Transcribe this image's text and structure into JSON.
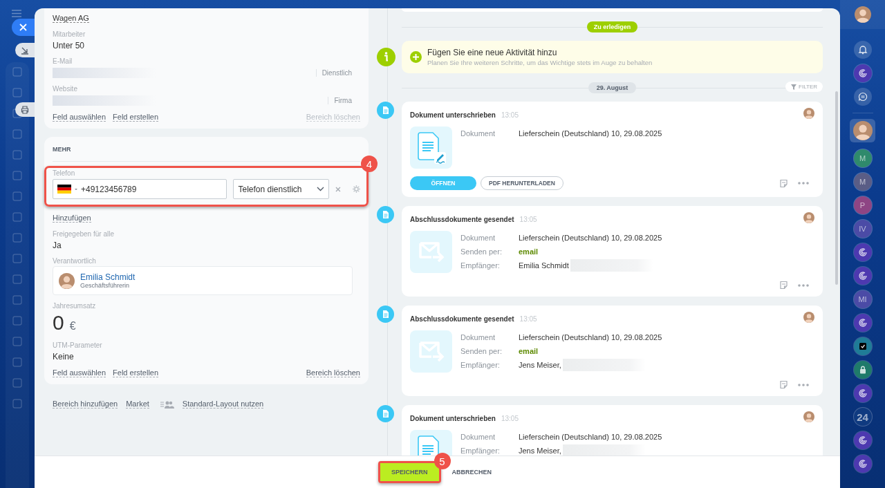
{
  "card_top": {
    "company_link": "Wagen AG",
    "employees": {
      "label": "Mitarbeiter",
      "value": "Unter 50"
    },
    "email": {
      "label": "E-Mail",
      "value_hidden": true,
      "type": "Dienstlich"
    },
    "website": {
      "label": "Website",
      "value_hidden": true,
      "type": "Firma"
    },
    "links": [
      "Feld auswählen",
      "Feld erstellen"
    ],
    "delete_link": "Bereich löschen",
    "delete_disabled": true
  },
  "section_more": {
    "title": "MEHR",
    "phone": {
      "label": "Telefon",
      "value": "+49123456789",
      "type": "Telefon dienstlich",
      "callout": "4"
    },
    "add_link": "Hinzufügen",
    "shared": {
      "label": "Freigegeben für alle",
      "value": "Ja"
    },
    "responsible": {
      "label": "Verantwortlich",
      "name": "Emilia Schmidt",
      "role": "Geschäftsführerin"
    },
    "revenue": {
      "label": "Jahresumsatz",
      "amount": "0",
      "currency": "€"
    },
    "utm": {
      "label": "UTM-Parameter",
      "value": "Keine"
    },
    "links": [
      "Feld auswählen",
      "Feld erstellen"
    ],
    "delete_link": "Bereich löschen",
    "delete_disabled": false
  },
  "footer_links": [
    "Bereich hinzufügen",
    "Market"
  ],
  "layout_link": "Standard-Layout nutzen",
  "timeline": {
    "todo_label": "Zu erledigen",
    "add_activity": {
      "title": "Fügen Sie eine neue Aktivität hinzu",
      "hint": "Planen Sie Ihre weiteren Schritte, um das Wichtige stets im Auge zu behalten"
    },
    "date_label": "29. August",
    "filter": "FILTER",
    "entries": [
      {
        "kind": "signed",
        "title": "Dokument unterschrieben",
        "time": "13:05",
        "show_tools": true,
        "rows": [
          {
            "label": "Dokument",
            "value": "Lieferschein (Deutschland) 10, 29.08.2025",
            "highlight": false,
            "redacted": false
          }
        ],
        "buttons": [
          "ÖFFNEN",
          "PDF HERUNTERLADEN"
        ]
      },
      {
        "kind": "sent",
        "title": "Abschlussdokumente gesendet",
        "time": "13:05",
        "show_tools": true,
        "rows": [
          {
            "label": "Dokument",
            "value": "Lieferschein (Deutschland) 10, 29.08.2025",
            "highlight": false,
            "redacted": false
          },
          {
            "label": "Senden per:",
            "value": "email",
            "highlight": true,
            "redacted": false
          },
          {
            "label": "Empfänger:",
            "value": "Emilia Schmidt",
            "highlight": false,
            "redacted": true
          }
        ]
      },
      {
        "kind": "sent",
        "title": "Abschlussdokumente gesendet",
        "time": "13:05",
        "show_tools": true,
        "rows": [
          {
            "label": "Dokument",
            "value": "Lieferschein (Deutschland) 10, 29.08.2025",
            "highlight": false,
            "redacted": false
          },
          {
            "label": "Senden per:",
            "value": "email",
            "highlight": true,
            "redacted": false
          },
          {
            "label": "Empfänger:",
            "value": "Jens Meiser,",
            "highlight": false,
            "redacted": true
          }
        ]
      },
      {
        "kind": "signed",
        "title": "Dokument unterschrieben",
        "time": "13:05",
        "show_tools": false,
        "rows": [
          {
            "label": "Dokument",
            "value": "Lieferschein (Deutschland) 10, 29.08.2025",
            "highlight": false,
            "redacted": false
          },
          {
            "label": "Empfänger:",
            "value": "Jens Meiser,",
            "highlight": false,
            "redacted": true
          }
        ]
      }
    ]
  },
  "actions": {
    "save": "SPEICHERN",
    "cancel": "ABBRECHEN",
    "callout": "5"
  },
  "right_bar": {
    "items": [
      {
        "kind": "bell"
      },
      {
        "kind": "spiral"
      },
      {
        "kind": "chat"
      },
      {
        "kind": "person",
        "selected": true
      },
      {
        "kind": "letter",
        "text": "M",
        "color": "#2f8a6c"
      },
      {
        "kind": "letter",
        "text": "M",
        "color": "#5a5d86"
      },
      {
        "kind": "letter",
        "text": "P",
        "color": "#8e4584"
      },
      {
        "kind": "letter",
        "text": "IV",
        "color": "#4b4ba6"
      },
      {
        "kind": "spiral"
      },
      {
        "kind": "spiral"
      },
      {
        "kind": "letter",
        "text": "MI",
        "color": "#4b4ba6"
      },
      {
        "kind": "spiral"
      },
      {
        "kind": "task"
      },
      {
        "kind": "lock"
      },
      {
        "kind": "spiral"
      },
      {
        "kind": "letter",
        "text": "24",
        "color": "#0f3a80"
      },
      {
        "kind": "spiral"
      },
      {
        "kind": "spiral"
      }
    ]
  }
}
